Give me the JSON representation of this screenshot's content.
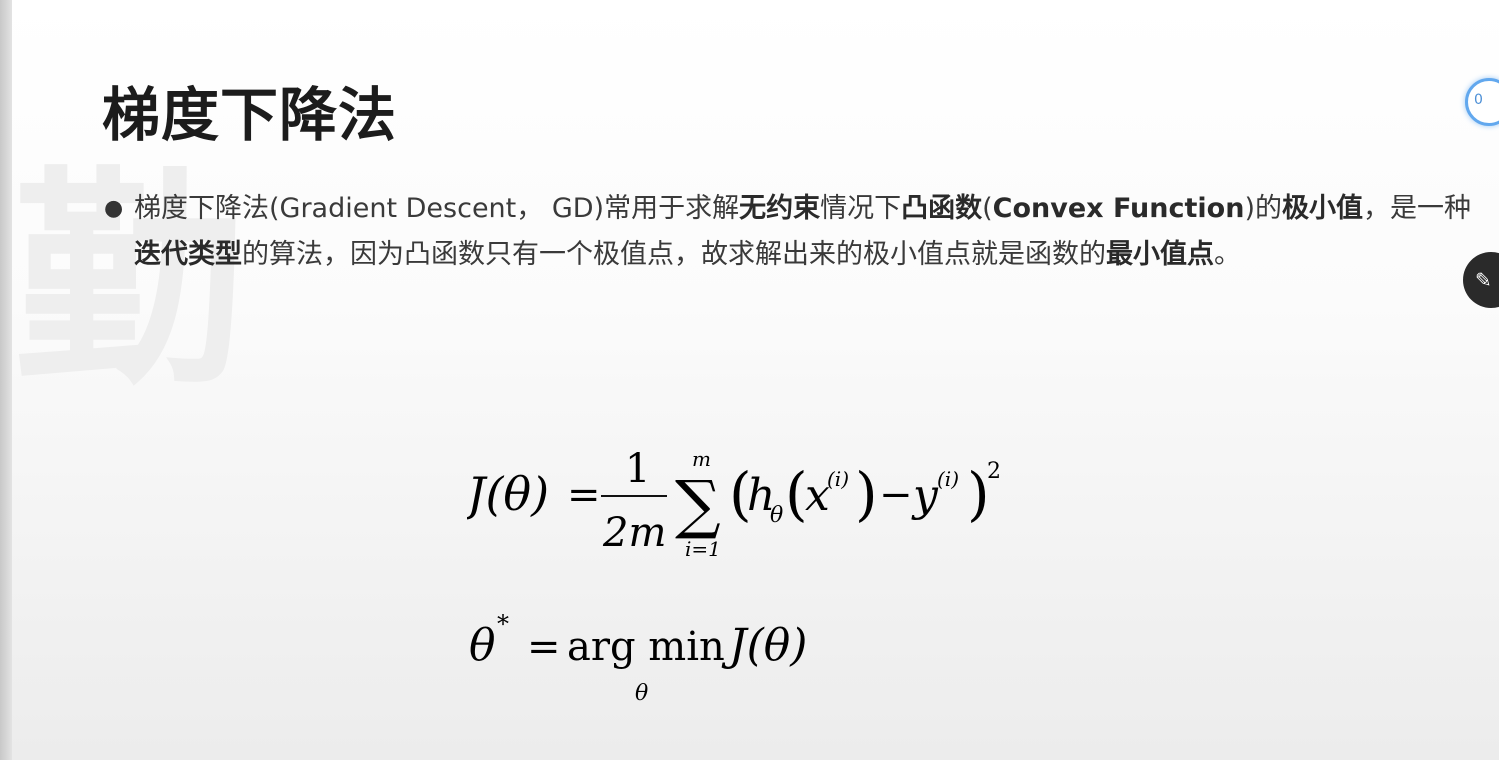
{
  "slide": {
    "title": "梯度下降法",
    "watermark": "勤",
    "bullet": {
      "text_1": "梯度下降法(Gradient Descent， GD)常用于求解",
      "bold_1": "无约束",
      "text_2": "情况下",
      "bold_2": "凸函数",
      "text_3": "(",
      "bold_3": "Convex Function",
      "text_4": ")的",
      "bold_4": "极小值",
      "text_5": "，是一种",
      "bold_5": "迭代类型",
      "text_6": "的算法，因为凸函数只有一个极值点，故求解出来的极小值点就是函数的",
      "bold_6": "最小值点",
      "text_7": "。"
    },
    "formula_1": {
      "lhs": "J(θ)",
      "eq": "=",
      "frac_num": "1",
      "frac_den": "2m",
      "sum_symbol": "∑",
      "sum_upper": "m",
      "sum_lower": "i=1",
      "h": "h",
      "h_sub": "θ",
      "x": "x",
      "x_sup": "(i)",
      "minus": "−",
      "y": "y",
      "y_sup": "(i)",
      "power": "2"
    },
    "formula_2": {
      "theta": "θ",
      "star": "*",
      "eq": "=",
      "argmin": "arg min",
      "under": "θ",
      "rhs": "J(θ)"
    }
  },
  "overlay": {
    "badge_text": "0",
    "badge_color": "#62a8ee",
    "pen_icon": "pen-icon"
  }
}
